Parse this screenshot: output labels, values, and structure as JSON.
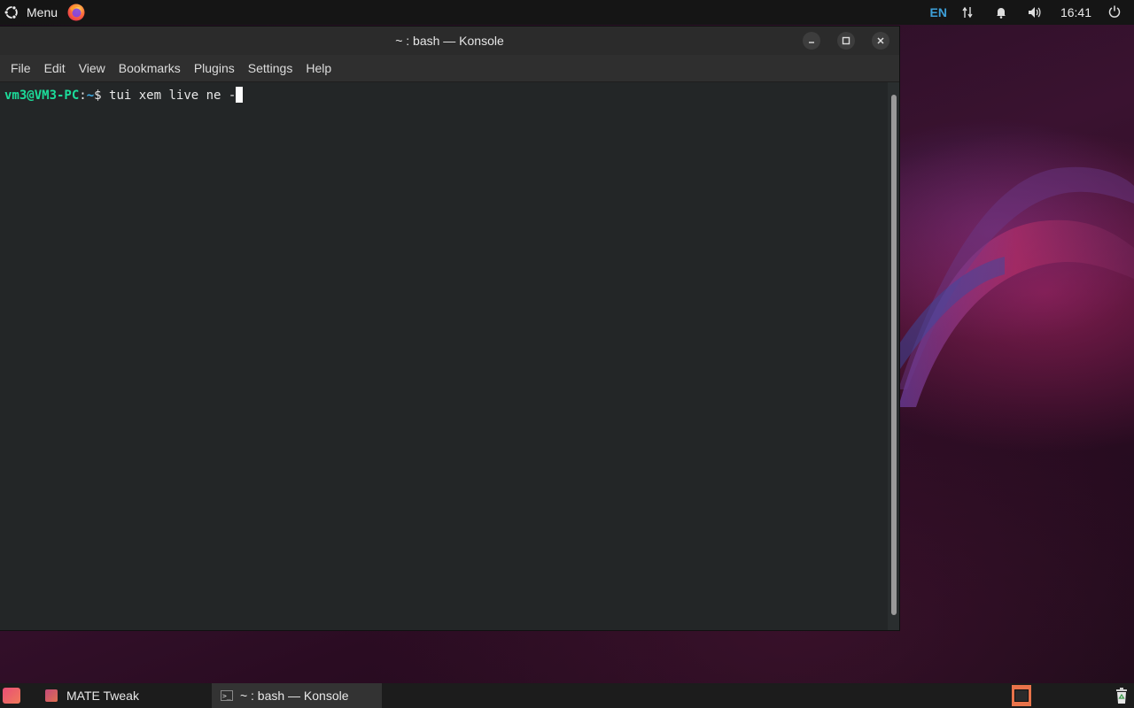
{
  "top_panel": {
    "menu_label": "Menu",
    "keyboard_layout": "EN",
    "clock": "16:41",
    "icons": [
      "ubuntu-logo-icon",
      "firefox-icon",
      "network-icon",
      "notification-bell-icon",
      "volume-icon",
      "power-icon"
    ]
  },
  "window": {
    "title": "~ : bash — Konsole",
    "menu": [
      "File",
      "Edit",
      "View",
      "Bookmarks",
      "Plugins",
      "Settings",
      "Help"
    ],
    "controls": [
      "minimize",
      "maximize",
      "close"
    ]
  },
  "terminal": {
    "user_host": "vm3@VM3-PC",
    "separator": ":",
    "path": "~",
    "prompt_symbol": "$ ",
    "command": "tui xem live ne -"
  },
  "taskbar": {
    "tasks": [
      {
        "label": "MATE Tweak",
        "active": false
      },
      {
        "label": "~ : bash — Konsole",
        "active": true
      }
    ]
  },
  "colors": {
    "prompt_user": "#1cdc9a",
    "prompt_path": "#3daee9",
    "terminal_bg": "#232627",
    "keyboard_layout": "#3d9fd8"
  }
}
